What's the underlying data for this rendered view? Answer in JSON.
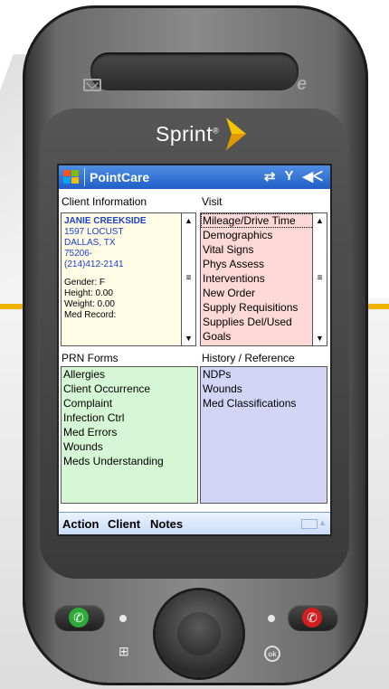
{
  "device": {
    "brand": "Sprint",
    "trademark": "®"
  },
  "titlebar": {
    "app_title": "PointCare"
  },
  "client_info": {
    "label": "Client Information",
    "name": "JANIE CREEKSIDE",
    "address_lines": [
      "1597 LOCUST",
      "DALLAS, TX",
      "75206-",
      "(214)412-2141"
    ],
    "attributes": [
      {
        "text": "Gender:  F"
      },
      {
        "text": "Height:   0.00"
      },
      {
        "text": "Weight:   0.00"
      },
      {
        "text": "Med Record:"
      }
    ]
  },
  "visit": {
    "label": "Visit",
    "items": [
      "Mileage/Drive Time",
      "Demographics",
      "Vital Signs",
      "Phys Assess",
      "Interventions",
      "New Order",
      "Supply Requisitions",
      "Supplies Del/Used",
      "Goals"
    ]
  },
  "prn_forms": {
    "label": "PRN Forms",
    "items": [
      "Allergies",
      "Client Occurrence",
      "Complaint",
      "Infection Ctrl",
      "Med Errors",
      "Wounds",
      "Meds Understanding"
    ]
  },
  "history": {
    "label": "History / Reference",
    "items": [
      "NDPs",
      "Wounds",
      "Med Classifications"
    ]
  },
  "softkeys": {
    "left": "Action",
    "middle": "Client",
    "right": "Notes"
  },
  "hardware": {
    "ok_label": "ok"
  },
  "colors": {
    "titlebar": "#1f5fc7",
    "client_bg": "#fffbe5",
    "visit_bg": "#fcd9d7",
    "prn_bg": "#d6f7d6",
    "history_bg": "#d4d4f6",
    "client_text": "#1a3fd1"
  }
}
